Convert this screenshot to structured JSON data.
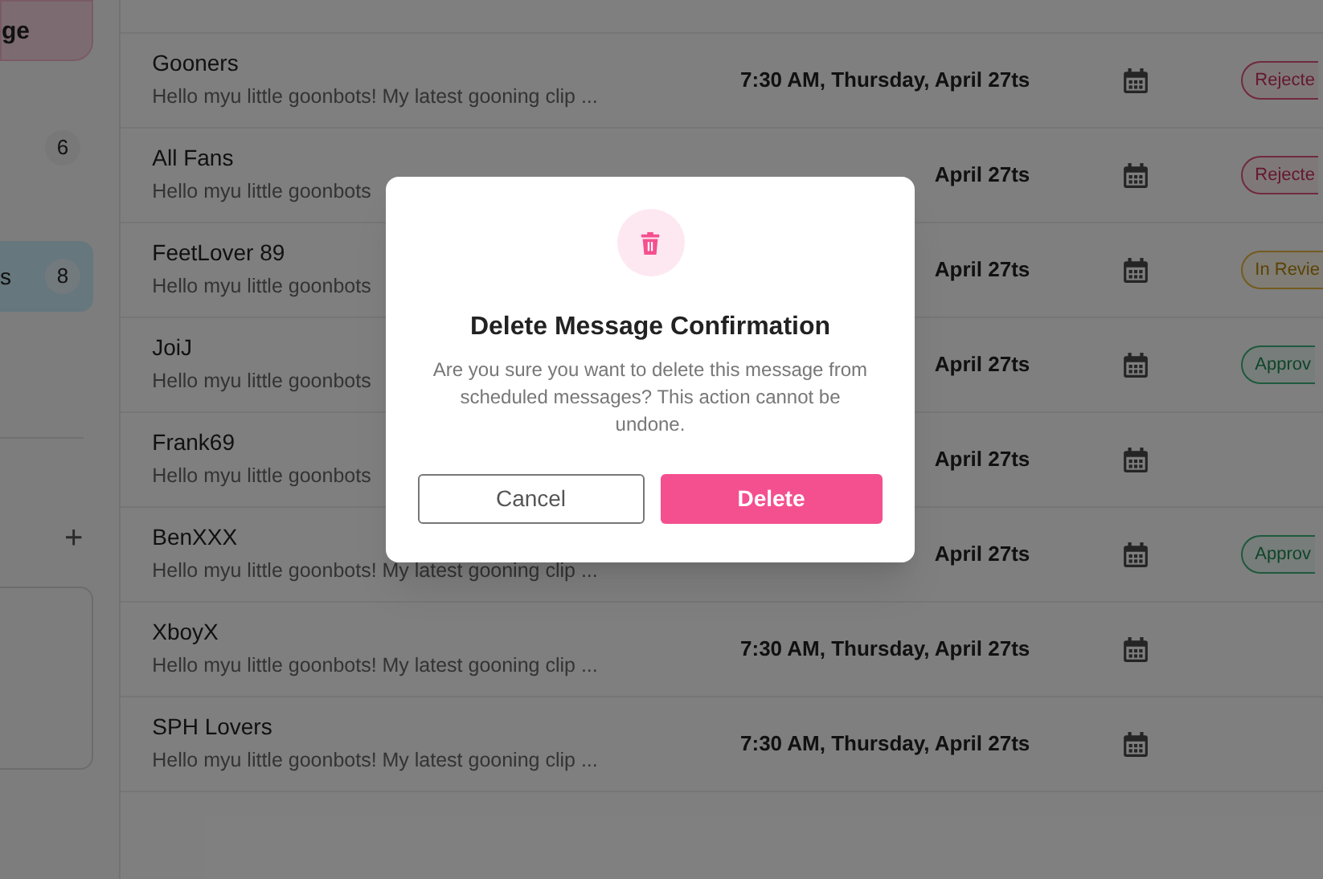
{
  "sidebar": {
    "top_button": {
      "label": "ge"
    },
    "items": [
      {
        "count": "6",
        "selected": false
      },
      {
        "label": "s",
        "count": "8",
        "selected": true
      }
    ],
    "add_button": {
      "label": "+"
    }
  },
  "messages": [
    {
      "name": "Gooners",
      "preview": "Hello myu little goonbots! My latest gooning clip ...",
      "time": "7:30 AM, Thursday, April 27ts",
      "status": {
        "kind": "rejected",
        "label": "Rejecte"
      }
    },
    {
      "name": "All Fans",
      "preview": "Hello myu little goonbots",
      "time": "April 27ts",
      "status": {
        "kind": "rejected",
        "label": "Rejecte"
      }
    },
    {
      "name": "FeetLover 89",
      "preview": "Hello myu little goonbots",
      "time": "April 27ts",
      "status": {
        "kind": "review",
        "label": "In Revie"
      }
    },
    {
      "name": "JoiJ",
      "preview": "Hello myu little goonbots",
      "time": "April 27ts",
      "status": {
        "kind": "approved",
        "label": "Approv"
      }
    },
    {
      "name": "Frank69",
      "preview": "Hello myu little goonbots",
      "time": "April 27ts"
    },
    {
      "name": "BenXXX",
      "preview": "Hello myu little goonbots! My latest gooning clip ...",
      "time": "April 27ts",
      "status": {
        "kind": "approved",
        "label": "Approv"
      }
    },
    {
      "name": "XboyX",
      "preview": "Hello myu little goonbots! My latest gooning clip ...",
      "time": "7:30 AM, Thursday, April 27ts"
    },
    {
      "name": "SPH Lovers",
      "preview": "Hello myu little goonbots! My latest gooning clip ...",
      "time": "7:30 AM, Thursday, April 27ts"
    }
  ],
  "dialog": {
    "title": "Delete Message Confirmation",
    "message": "Are you sure you want to delete this message from scheduled messages? This action cannot be undone.",
    "cancel": "Cancel",
    "confirm": "Delete"
  }
}
